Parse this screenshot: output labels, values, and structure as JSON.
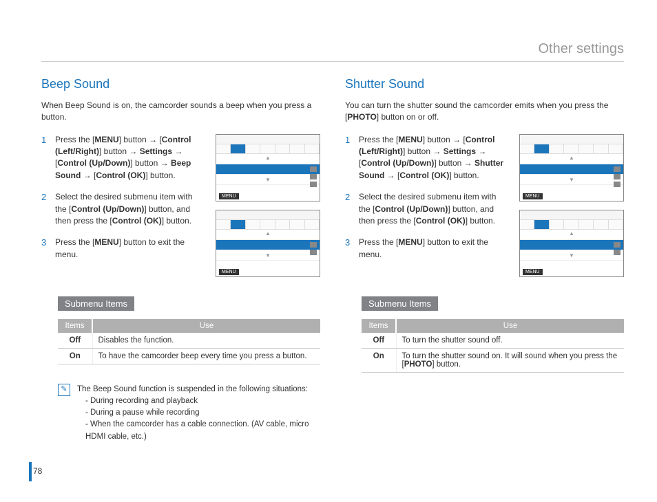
{
  "pageHeader": "Other settings",
  "pageNumber": "78",
  "left": {
    "title": "Beep Sound",
    "intro": "When Beep Sound is on, the camcorder sounds a beep when you press a button.",
    "steps": [
      "Press the [<b>MENU</b>] button → [<b>Control (Left/Right)</b>] button → <b>Settings</b> → [<b>Control (Up/Down)</b>] button → <b>Beep Sound</b> → [<b>Control (OK)</b>] button.",
      "Select the desired submenu item with the [<b>Control (Up/Down)</b>] button, and then press the [<b>Control (OK)</b>] button.",
      "Press the [<b>MENU</b>] button to exit the menu."
    ],
    "submenuLabel": "Submenu Items",
    "tableHead": {
      "items": "Items",
      "use": "Use"
    },
    "tableRows": [
      {
        "item": "Off",
        "use": "Disables the function."
      },
      {
        "item": "On",
        "use": "To have the camcorder beep every time you press a button."
      }
    ],
    "note": {
      "lead": "The Beep Sound function is suspended in the following situations:",
      "bullets": [
        "During recording and playback",
        "During a pause while recording",
        "When the camcorder has a cable connection. (AV cable, micro HDMI cable, etc.)"
      ]
    }
  },
  "right": {
    "title": "Shutter Sound",
    "intro": "You can turn the shutter sound the camcorder emits when you press the [<b>PHOTO</b>] button on or off.",
    "steps": [
      "Press the [<b>MENU</b>] button → [<b>Control (Left/Right)</b>] button → <b>Settings</b> → [<b>Control (Up/Down)</b>] button → <b>Shutter Sound</b> → [<b>Control (OK)</b>] button.",
      "Select the desired submenu item with the [<b>Control (Up/Down)</b>] button, and then press the [<b>Control (OK)</b>] button.",
      "Press the [<b>MENU</b>] button to exit the menu."
    ],
    "submenuLabel": "Submenu Items",
    "tableHead": {
      "items": "Items",
      "use": "Use"
    },
    "tableRows": [
      {
        "item": "Off",
        "use": "To turn the shutter sound off."
      },
      {
        "item": "On",
        "use": "To turn the shutter sound on. It will sound when you press the [<b>PHOTO</b>] button."
      }
    ]
  },
  "menuLabel": "MENU"
}
